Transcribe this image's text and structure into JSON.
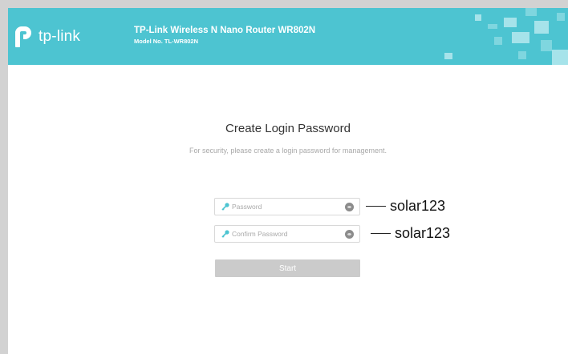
{
  "header": {
    "logo_text": "tp-link",
    "product_title": "TP-Link Wireless N Nano Router WR802N",
    "model_line": "Model No. TL-WR802N"
  },
  "main": {
    "title": "Create Login Password",
    "subtitle": "For security, please create a login password for management.",
    "password": {
      "placeholder": "Password",
      "icon": "key-icon",
      "toggle_icon": "eye-icon"
    },
    "confirm": {
      "placeholder": "Confirm Password",
      "icon": "key-icon",
      "toggle_icon": "eye-icon"
    },
    "start_label": "Start"
  },
  "annotations": {
    "password_note": "solar123",
    "confirm_note": "solar123"
  },
  "colors": {
    "header_bg": "#4dc4d1",
    "button_bg": "#cbcbcb",
    "key_icon": "#4dc4d1"
  }
}
